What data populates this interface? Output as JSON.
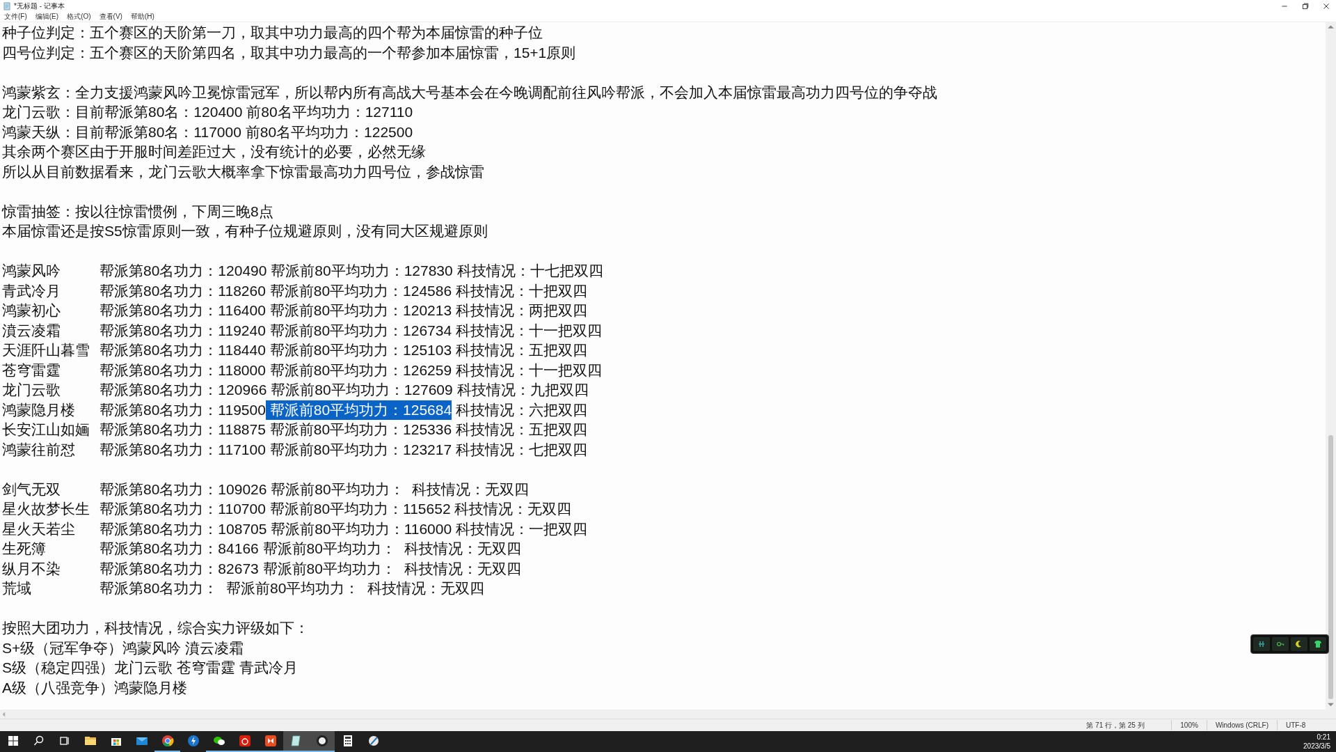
{
  "window": {
    "title": "*无标题 - 记事本"
  },
  "menu": [
    "文件(F)",
    "编辑(E)",
    "格式(O)",
    "查看(V)",
    "帮助(H)"
  ],
  "lines": [
    {
      "kind": "text",
      "text": "种子位判定：五个赛区的天阶第一刀，取其中功力最高的四个帮为本届惊雷的种子位"
    },
    {
      "kind": "text",
      "text": "四号位判定：五个赛区的天阶第四名，取其中功力最高的一个帮参加本届惊雷，15+1原则"
    },
    {
      "kind": "blank"
    },
    {
      "kind": "text",
      "text": "鸿蒙紫玄：全力支援鸿蒙风吟卫冕惊雷冠军，所以帮内所有高战大号基本会在今晚调配前往风吟帮派，不会加入本届惊雷最高功力四号位的争夺战"
    },
    {
      "kind": "text",
      "text": "龙门云歌：目前帮派第80名：120400 前80名平均功力：127110"
    },
    {
      "kind": "text",
      "text": "鸿蒙天纵：目前帮派第80名：117000 前80名平均功力：122500"
    },
    {
      "kind": "text",
      "text": "其余两个赛区由于开服时间差距过大，没有统计的必要，必然无缘"
    },
    {
      "kind": "text",
      "text": "所以从目前数据看来，龙门云歌大概率拿下惊雷最高功力四号位，参战惊雷"
    },
    {
      "kind": "blank"
    },
    {
      "kind": "text",
      "text": "惊雷抽签：按以往惊雷惯例，下周三晚8点"
    },
    {
      "kind": "text",
      "text": "本届惊雷还是按S5惊雷原则一致，有种子位规避原则，没有同大区规避原则"
    },
    {
      "kind": "blank"
    },
    {
      "kind": "row",
      "name": "鸿蒙风吟",
      "segments": [
        {
          "text": "帮派第80名功力：120490 帮派前80平均功力：127830 科技情况：十七把双四",
          "selected": false
        }
      ]
    },
    {
      "kind": "row",
      "name": "青武冷月",
      "segments": [
        {
          "text": "帮派第80名功力：118260 帮派前80平均功力：124586 科技情况：十把双四",
          "selected": false
        }
      ]
    },
    {
      "kind": "row",
      "name": "鸿蒙初心",
      "segments": [
        {
          "text": "帮派第80名功力：116400 帮派前80平均功力：120213 科技情况：两把双四",
          "selected": false
        }
      ]
    },
    {
      "kind": "row",
      "name": "濆云凌霜",
      "segments": [
        {
          "text": "帮派第80名功力：119240 帮派前80平均功力：126734 科技情况：十一把双四",
          "selected": false
        }
      ]
    },
    {
      "kind": "row",
      "name": "天涯阡山暮雪",
      "segments": [
        {
          "text": "帮派第80名功力：118440 帮派前80平均功力：125103 科技情况：五把双四",
          "selected": false
        }
      ]
    },
    {
      "kind": "row",
      "name": "苍穹雷霆",
      "segments": [
        {
          "text": "帮派第80名功力：118000 帮派前80平均功力：126259 科技情况：十一把双四",
          "selected": false
        }
      ]
    },
    {
      "kind": "row",
      "name": "龙门云歌",
      "segments": [
        {
          "text": "帮派第80名功力：120966 帮派前80平均功力：127609 科技情况：九把双四",
          "selected": false
        }
      ]
    },
    {
      "kind": "row",
      "name": "鸿蒙隐月楼",
      "segments": [
        {
          "text": "帮派第80名功力：119500",
          "selected": false
        },
        {
          "text": " 帮派前80平均功力：125684",
          "selected": true
        },
        {
          "text": " 科技情况：六把双四",
          "selected": false
        }
      ]
    },
    {
      "kind": "row",
      "name": "长安江山如婳",
      "segments": [
        {
          "text": "帮派第80名功力：118875 帮派前80平均功力：125336 科技情况：五把双四",
          "selected": false
        }
      ]
    },
    {
      "kind": "row",
      "name": "鸿蒙往前怼",
      "segments": [
        {
          "text": "帮派第80名功力：117100 帮派前80平均功力：123217 科技情况：七把双四",
          "selected": false
        }
      ]
    },
    {
      "kind": "blank"
    },
    {
      "kind": "row",
      "name": "剑气无双",
      "segments": [
        {
          "text": "帮派第80名功力：109026 帮派前80平均功力：  科技情况：无双四",
          "selected": false
        }
      ]
    },
    {
      "kind": "row",
      "name": "星火故梦长生",
      "segments": [
        {
          "text": "帮派第80名功力：110700 帮派前80平均功力：115652 科技情况：无双四",
          "selected": false
        }
      ]
    },
    {
      "kind": "row",
      "name": "星火天若尘",
      "segments": [
        {
          "text": "帮派第80名功力：108705 帮派前80平均功力：116000 科技情况：一把双四",
          "selected": false
        }
      ]
    },
    {
      "kind": "row",
      "name": "生死簿",
      "segments": [
        {
          "text": "帮派第80名功力：84166 帮派前80平均功力：  科技情况：无双四",
          "selected": false
        }
      ]
    },
    {
      "kind": "row",
      "name": "纵月不染",
      "segments": [
        {
          "text": "帮派第80名功力：82673 帮派前80平均功力：  科技情况：无双四",
          "selected": false
        }
      ]
    },
    {
      "kind": "row",
      "name": "荒域",
      "segments": [
        {
          "text": "帮派第80名功力：  帮派前80平均功力：  科技情况：无双四",
          "selected": false
        }
      ]
    },
    {
      "kind": "blank"
    },
    {
      "kind": "text",
      "text": "按照大团功力，科技情况，综合实力评级如下："
    },
    {
      "kind": "text",
      "text": "S+级（冠军争夺）鸿蒙风吟 濆云凌霜"
    },
    {
      "kind": "text",
      "text": "S级（稳定四强）龙门云歌 苍穹雷霆 青武冷月"
    },
    {
      "kind": "text",
      "text": "A级（八强竞争）鸿蒙隐月楼"
    }
  ],
  "status_bar": {
    "position": "第 71 行，第 25 列",
    "zoom": "100%",
    "line_ending": "Windows (CRLF)",
    "encoding": "UTF-8"
  },
  "taskbar": {
    "apps": [
      {
        "open": false,
        "active": false
      },
      {
        "open": false,
        "active": false
      },
      {
        "open": false,
        "active": false
      },
      {
        "open": false,
        "active": false
      },
      {
        "open": false,
        "active": false
      },
      {
        "open": false,
        "active": false
      },
      {
        "open": true,
        "active": false
      },
      {
        "open": false,
        "active": false
      },
      {
        "open": true,
        "active": false
      },
      {
        "open": true,
        "active": false
      },
      {
        "open": true,
        "active": false
      },
      {
        "open": true,
        "active": true
      },
      {
        "open": true,
        "active": true
      },
      {
        "open": false,
        "active": false
      },
      {
        "open": false,
        "active": false
      }
    ],
    "time": "0:21",
    "date": "2023/3/5"
  }
}
